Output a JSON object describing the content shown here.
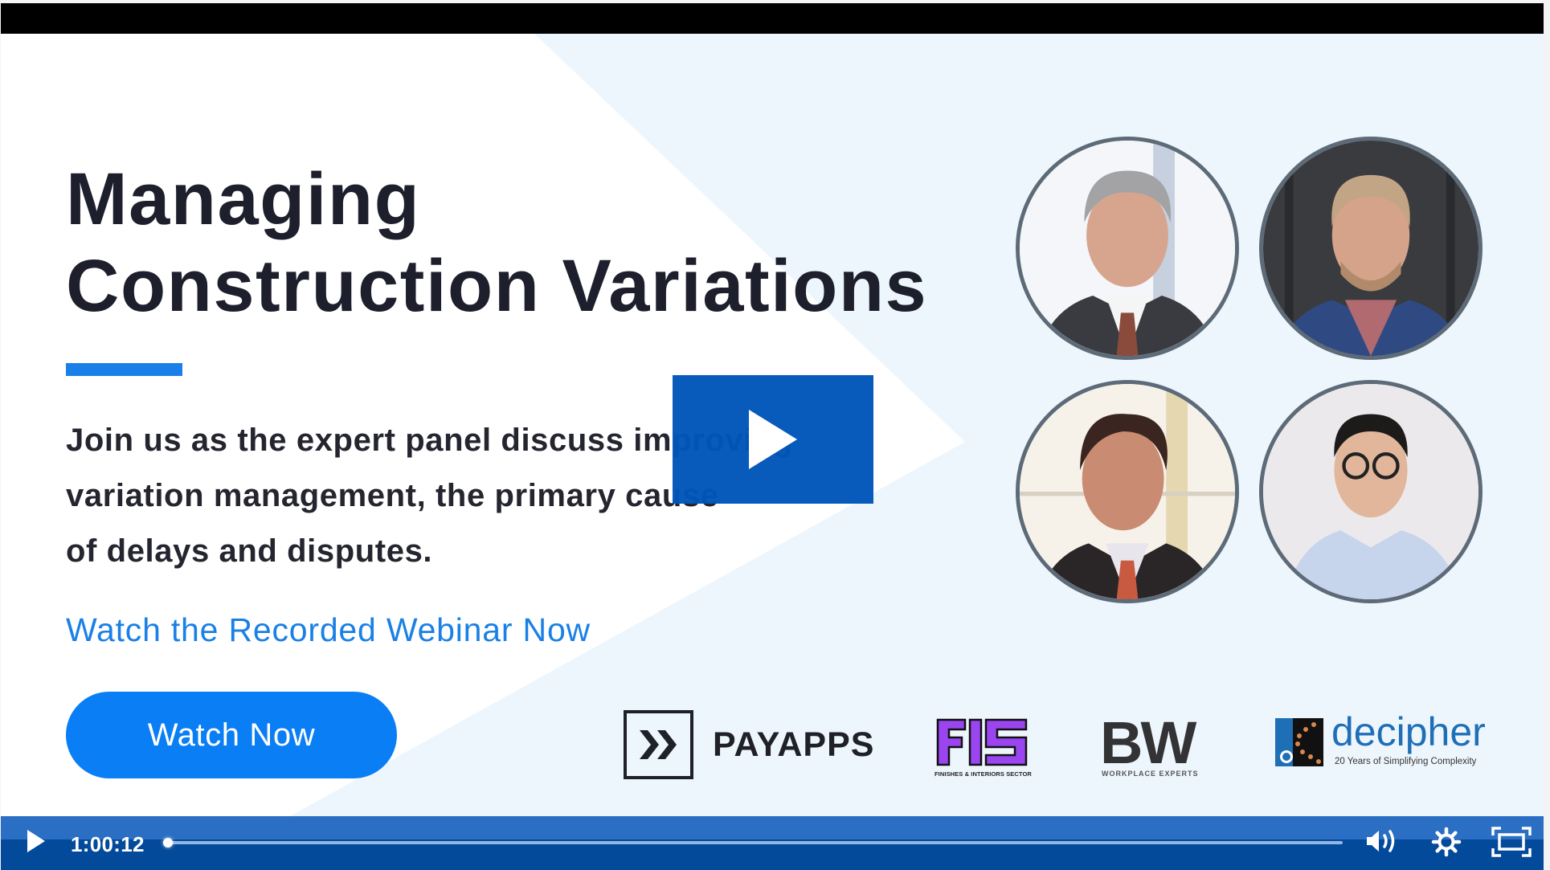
{
  "slide": {
    "title_lines": [
      "Managing",
      "Construction Variations"
    ],
    "body_lines": [
      "Join us as the expert panel discuss improving",
      "variation management, the primary cause",
      "of delays and disputes."
    ],
    "cta_text": "Watch the Recorded Webinar Now",
    "button_label": "Watch Now",
    "colors": {
      "title": "#1e1f2c",
      "accent": "#1a7fe8",
      "cta": "#1a80e6",
      "button": "#0a7ef5",
      "background_tint": "#eef6fd"
    },
    "speakers": [
      {
        "portrait": "speaker-1"
      },
      {
        "portrait": "speaker-2"
      },
      {
        "portrait": "speaker-3"
      },
      {
        "portrait": "speaker-4"
      }
    ],
    "logos": {
      "payapps": {
        "icon": "double-chevron-icon",
        "name": "PAYAPPS"
      },
      "fis": {
        "mark": "FIS",
        "subtitle": "FINISHES & INTERIORS SECTOR",
        "color": "#9b45f0"
      },
      "bw": {
        "mark": "BW",
        "subtitle": "WORKPLACE EXPERTS"
      },
      "decipher": {
        "name": "decipher",
        "tagline": "20 Years of Simplifying Complexity",
        "color": "#1f6fb6"
      }
    }
  },
  "player": {
    "big_play_icon": "play-icon",
    "current_time": "1:00:12",
    "progress": 0.0,
    "controls": {
      "play": "play-icon",
      "volume": "volume-icon",
      "settings": "gear-icon",
      "fullscreen": "fullscreen-icon"
    },
    "colors": {
      "bar_top": "#2a6fc3",
      "bar_bottom": "#044a9a",
      "track": "#93b6e2",
      "overlay": "#0056b8"
    }
  }
}
